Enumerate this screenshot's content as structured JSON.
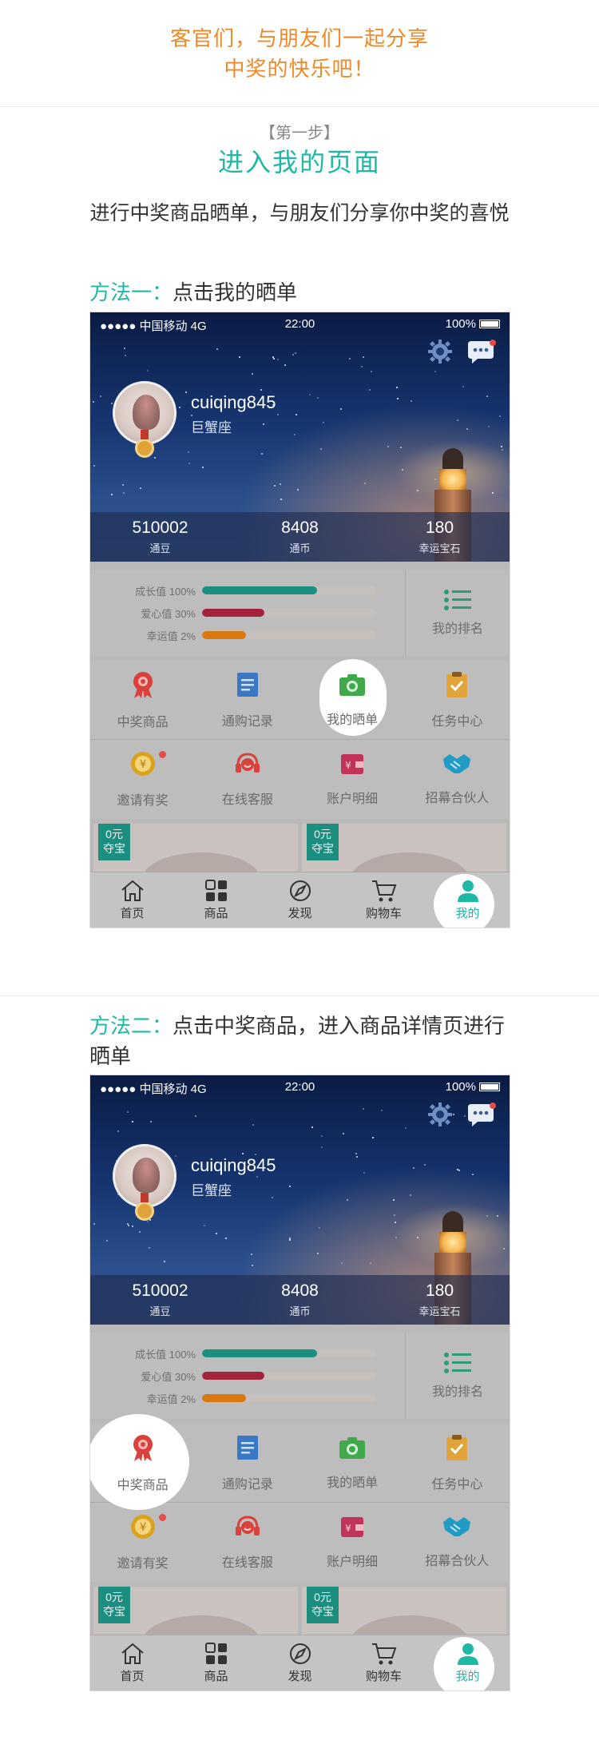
{
  "intro": {
    "line1": "客官们，与朋友们一起分享",
    "line2": "中奖的快乐吧！"
  },
  "step": {
    "tag": "【第一步】",
    "title": "进入我的页面",
    "desc": "进行中奖商品晒单，与朋友们分享你中奖的喜悦"
  },
  "methods": [
    {
      "lead": "方法一：",
      "text": "点击我的晒单"
    },
    {
      "lead": "方法二：",
      "text": "点击中奖商品，进入商品详情页进行晒单"
    }
  ],
  "phone": {
    "status": {
      "carrier": "●●●●● 中国移动 4G",
      "time": "22:00",
      "battery": "100%"
    },
    "icons": {
      "settings": "gear-icon",
      "messages": "chat-icon"
    },
    "user": {
      "name": "cuiqing845",
      "sign": "巨蟹座"
    },
    "stats": [
      {
        "num": "510002",
        "label": "通豆"
      },
      {
        "num": "8408",
        "label": "通币"
      },
      {
        "num": "180",
        "label": "幸运宝石"
      }
    ],
    "values": [
      {
        "label": "成长值 100%",
        "percent": 0.66,
        "color": "#1a8f82"
      },
      {
        "label": "爱心值 30%",
        "percent": 0.36,
        "color": "#a3233a"
      },
      {
        "label": "幸运值 2%",
        "percent": 0.25,
        "color": "#d9780f"
      }
    ],
    "rank_label": "我的排名",
    "grid": [
      {
        "label": "中奖商品",
        "icon": "award-icon",
        "color": "#d9423c"
      },
      {
        "label": "通购记录",
        "icon": "document-icon",
        "color": "#3a78c4"
      },
      {
        "label": "我的晒单",
        "icon": "camera-icon",
        "color": "#3fa94c"
      },
      {
        "label": "任务中心",
        "icon": "clipboard-icon",
        "color": "#e0a43a"
      },
      {
        "label": "邀请有奖",
        "icon": "coin-icon",
        "color": "#d9a31f"
      },
      {
        "label": "在线客服",
        "icon": "headset-icon",
        "color": "#d9423c"
      },
      {
        "label": "账户明细",
        "icon": "wallet-icon",
        "color": "#c2335a"
      },
      {
        "label": "招幕合伙人",
        "icon": "handshake-icon",
        "color": "#1f9bc4"
      }
    ],
    "promo_tag": "0元\n夺宝",
    "promo_tag_line1": "0元",
    "promo_tag_line2": "夺宝",
    "tabs": [
      {
        "label": "首页",
        "icon": "home-icon"
      },
      {
        "label": "商品",
        "icon": "grid-icon"
      },
      {
        "label": "发现",
        "icon": "compass-icon"
      },
      {
        "label": "购物车",
        "icon": "cart-icon"
      },
      {
        "label": "我的",
        "icon": "user-icon"
      }
    ],
    "colors": {
      "accent": "#1fb8a6",
      "highlight": "#ffffff"
    }
  }
}
